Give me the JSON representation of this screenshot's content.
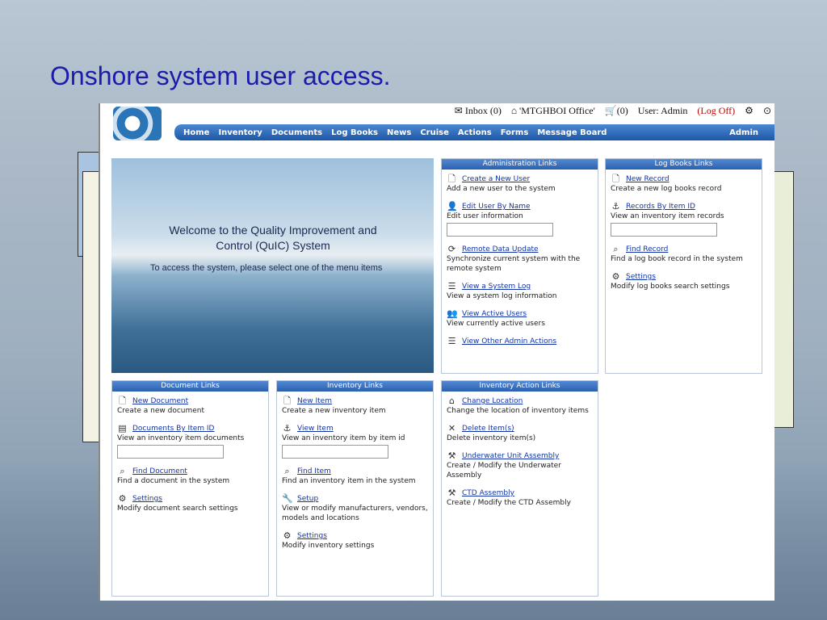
{
  "slide_title": "Onshore system user access.",
  "topbar": {
    "inbox": "Inbox (0)",
    "office": "'MTGHBOI Office'",
    "cart": "(0)",
    "user": "User: Admin",
    "logoff": "(Log Off)"
  },
  "nav": [
    "Home",
    "Inventory",
    "Documents",
    "Log Books",
    "News",
    "Cruise",
    "Actions",
    "Forms",
    "Message Board"
  ],
  "nav_admin": "Admin",
  "welcome": {
    "title": "Welcome to the Quality Improvement and Control (QuIC) System",
    "subtitle": "To access the system,  please select one of the menu items"
  },
  "admin_links": {
    "title": "Administration Links",
    "items": [
      {
        "icon": "page-icon",
        "link": "Create a New User",
        "desc": "Add a new user to the system"
      },
      {
        "icon": "user-icon",
        "link": "Edit User By Name",
        "desc": "Edit user information"
      },
      {
        "icon": "sync-icon",
        "link": "Remote Data Update",
        "desc": "Synchronize current system with the remote system"
      },
      {
        "icon": "log-icon",
        "link": "View a System Log",
        "desc": "View a system log information"
      },
      {
        "icon": "users-icon",
        "link": "View Active Users",
        "desc": "View currently active users"
      },
      {
        "icon": "list-icon",
        "link": "View Other Admin Actions",
        "desc": ""
      }
    ]
  },
  "logbook_links": {
    "title": "Log Books Links",
    "items": [
      {
        "icon": "page-icon",
        "link": "New Record",
        "desc": "Create a new log books record"
      },
      {
        "icon": "anchor-icon",
        "link": "Records By Item ID",
        "desc": "View an inventory item records"
      },
      {
        "icon": "search-icon",
        "link": "Find Record",
        "desc": "Find a log book record in the system"
      },
      {
        "icon": "gear-icon",
        "link": "Settings",
        "desc": "Modify log books search settings"
      }
    ]
  },
  "document_links": {
    "title": "Document Links",
    "items": [
      {
        "icon": "page-icon",
        "link": "New Document",
        "desc": "Create a new document"
      },
      {
        "icon": "pdf-icon",
        "link": "Documents By Item ID",
        "desc": "View an inventory item documents"
      },
      {
        "icon": "search-icon",
        "link": "Find Document",
        "desc": "Find a document in the system"
      },
      {
        "icon": "gear-icon",
        "link": "Settings",
        "desc": "Modify document search settings"
      }
    ]
  },
  "inventory_links": {
    "title": "Inventory Links",
    "items": [
      {
        "icon": "page-icon",
        "link": "New Item",
        "desc": "Create a new inventory item"
      },
      {
        "icon": "anchor-icon",
        "link": "View Item",
        "desc": "View an inventory item by item id"
      },
      {
        "icon": "search-icon",
        "link": "Find Item",
        "desc": "Find an inventory item in the system"
      },
      {
        "icon": "wrench-icon",
        "link": "Setup",
        "desc": "View or modify manufacturers, vendors, models and locations"
      },
      {
        "icon": "gear-icon",
        "link": "Settings",
        "desc": "Modify inventory settings"
      }
    ]
  },
  "inventory_action_links": {
    "title": "Inventory Action Links",
    "items": [
      {
        "icon": "home-icon",
        "link": "Change Location",
        "desc": "Change the location of inventory items"
      },
      {
        "icon": "delete-icon",
        "link": "Delete Item(s)",
        "desc": "Delete inventory item(s)"
      },
      {
        "icon": "tool-icon",
        "link": "Underwater Unit Assembly",
        "desc": "Create / Modify the Underwater Assembly"
      },
      {
        "icon": "tool-icon",
        "link": "CTD Assembly",
        "desc": "Create / Modify the CTD Assembly"
      }
    ]
  }
}
